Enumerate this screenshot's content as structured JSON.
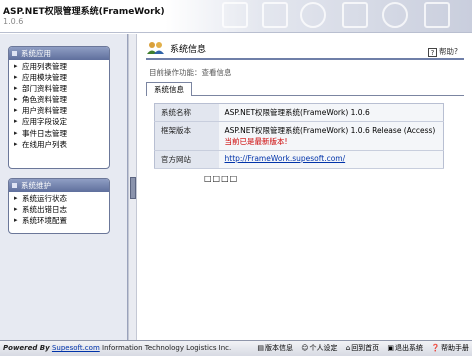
{
  "header": {
    "title": "ASP.NET权限管理系统(FrameWork)",
    "version": "1.0.6"
  },
  "sidebar": {
    "groups": [
      {
        "title": "系统应用",
        "items": [
          {
            "label": "应用列表管理"
          },
          {
            "label": "应用模块管理"
          },
          {
            "label": "部门资料管理"
          },
          {
            "label": "角色资料管理"
          },
          {
            "label": "用户资料管理"
          },
          {
            "label": "应用字段设定"
          },
          {
            "label": "事件日志管理"
          },
          {
            "label": "在线用户列表"
          }
        ]
      },
      {
        "title": "系统维护",
        "items": [
          {
            "label": "系统运行状态"
          },
          {
            "label": "系统出错日志"
          },
          {
            "label": "系统环境配置"
          }
        ]
      }
    ]
  },
  "content": {
    "title": "系统信息",
    "help_label": "帮助?",
    "current_function": "目前操作功能：查看信息",
    "tab_label": "系统信息",
    "rows": [
      {
        "key": "系统名称",
        "value": "ASP.NET权限管理系统(FrameWork) 1.0.6"
      },
      {
        "key": "框架版本",
        "value": "ASP.NET权限管理系统(FrameWork) 1.0.6 Release (Access)",
        "note": "当前已是最新版本!"
      },
      {
        "key": "官方网站",
        "value": "http://FrameWork.supesoft.com/"
      }
    ],
    "pager": "□□□□"
  },
  "statusbar": {
    "powered_prefix": "Powered By",
    "powered_link": "Supesoft.com",
    "powered_suffix": "Information Technology Logistics Inc.",
    "links": [
      {
        "label": "版本信息",
        "icon": "info-icon"
      },
      {
        "label": "个人设定",
        "icon": "person-icon"
      },
      {
        "label": "回到首页",
        "icon": "home-icon"
      },
      {
        "label": "退出系统",
        "icon": "exit-icon"
      },
      {
        "label": "帮助手册",
        "icon": "help-icon"
      }
    ]
  },
  "colors": {
    "group_header": "#6b7aa5",
    "accent_rule": "#6f7fa8",
    "warning": "#cc0000",
    "link": "#0033aa"
  }
}
